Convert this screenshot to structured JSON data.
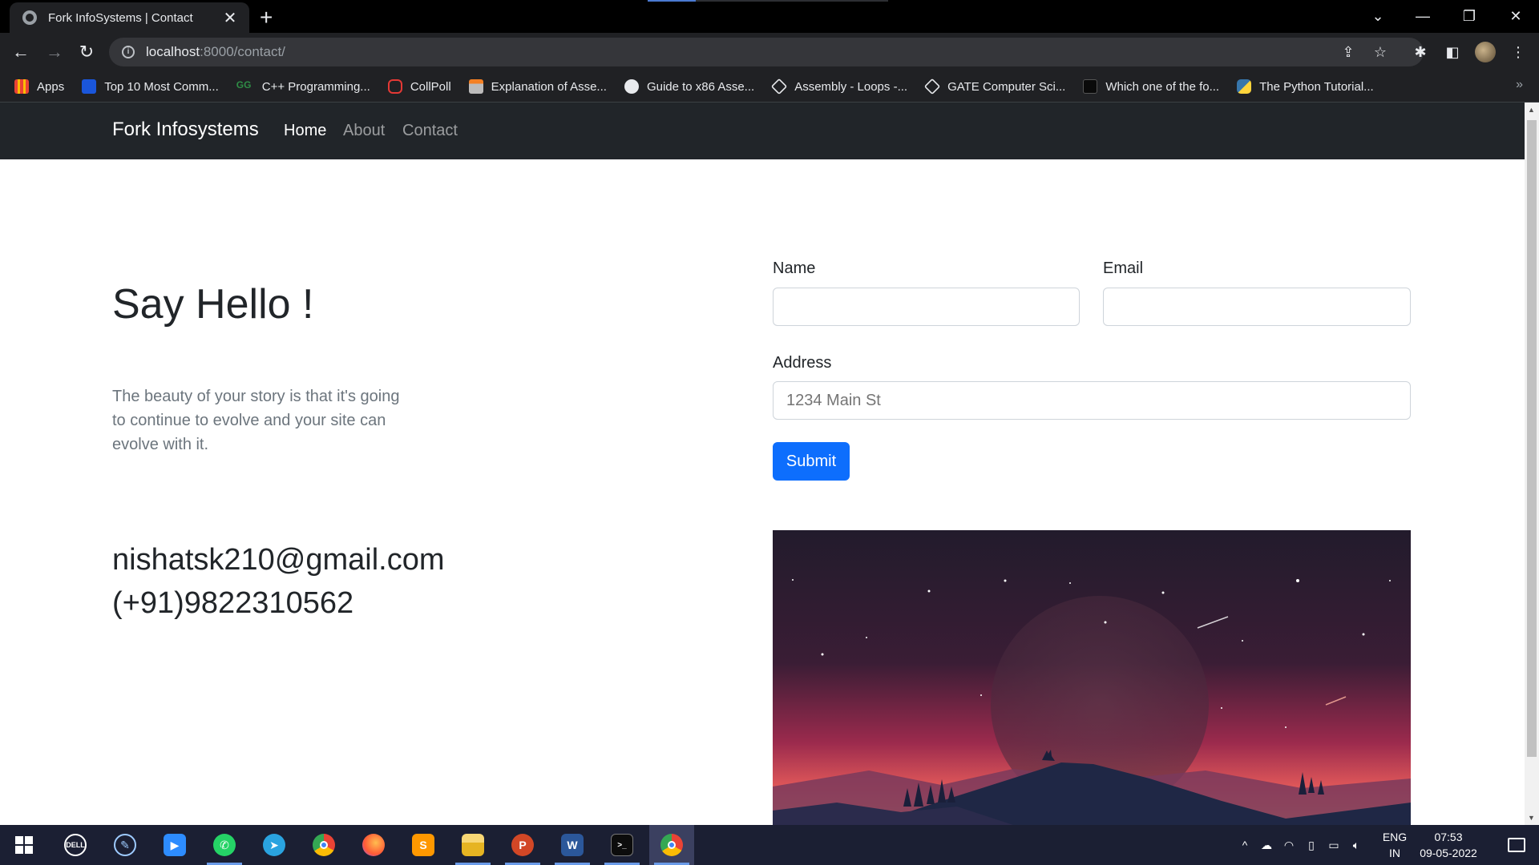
{
  "browser": {
    "tab_title": "Fork InfoSystems | Contact",
    "url_host": "localhost",
    "url_path": ":8000/contact/",
    "bookmarks": [
      {
        "label": "Apps",
        "color": "#4285f4"
      },
      {
        "label": "Top 10 Most Comm...",
        "color": "#1a56db"
      },
      {
        "label": "C++ Programming...",
        "color": "#2f8d46"
      },
      {
        "label": "CollPoll",
        "color": "#e53935"
      },
      {
        "label": "Explanation of Asse...",
        "color": "#f48024"
      },
      {
        "label": "Guide to x86 Asse...",
        "color": "#e8eaed"
      },
      {
        "label": "Assembly - Loops -...",
        "color": "#e8eaed"
      },
      {
        "label": "GATE Computer Sci...",
        "color": "#e8eaed"
      },
      {
        "label": "Which one of the fo...",
        "color": "#111111"
      },
      {
        "label": "The Python Tutorial...",
        "color": "#ffd43b"
      }
    ]
  },
  "site": {
    "brand": "Fork Infosystems",
    "nav": [
      "Home",
      "About",
      "Contact"
    ],
    "heading": "Say Hello !",
    "lead": "The beauty of your story is that it's going to continue to evolve and your site can evolve with it.",
    "email": "nishatsk210@gmail.com",
    "phone": "(+91)9822310562",
    "form": {
      "name_label": "Name",
      "email_label": "Email",
      "address_label": "Address",
      "address_placeholder": "1234 Main St",
      "submit_label": "Submit"
    }
  },
  "taskbar": {
    "apps": [
      "start-icon",
      "dell-icon",
      "dell-support-icon",
      "zoom-icon",
      "whatsapp-icon",
      "telegram-icon",
      "chrome-icon",
      "firefox-icon",
      "sublime-icon",
      "file-explorer-icon",
      "powerpoint-icon",
      "word-icon",
      "terminal-icon",
      "chrome-dev-icon"
    ],
    "lang_top": "ENG",
    "lang_bottom": "IN",
    "time": "07:53",
    "date": "09-05-2022"
  }
}
